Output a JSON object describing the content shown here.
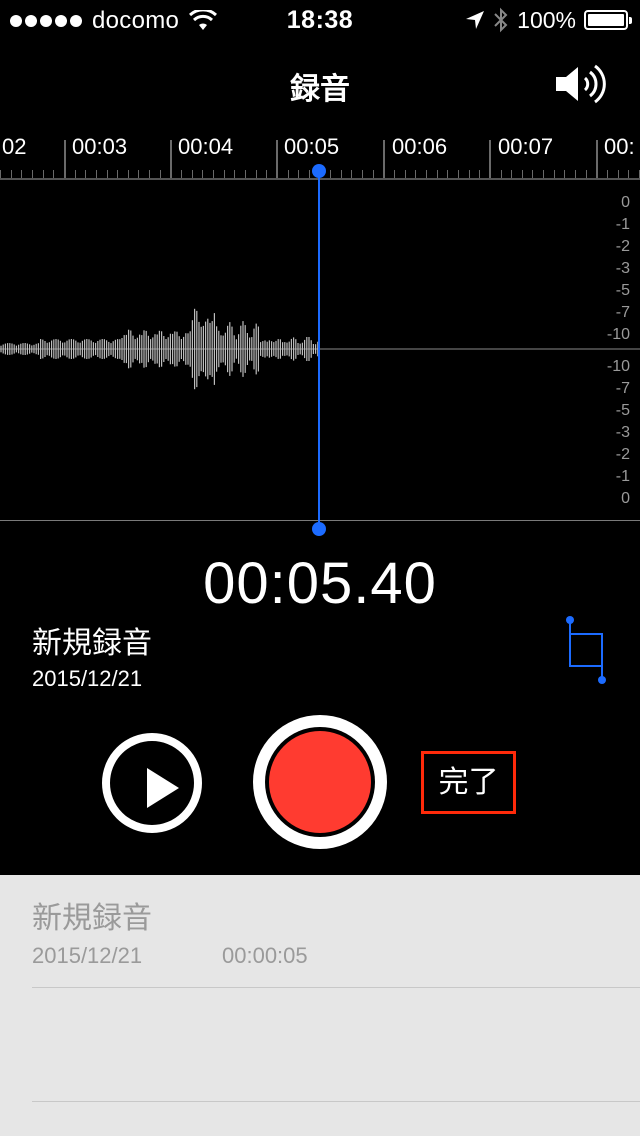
{
  "status_bar": {
    "carrier": "docomo",
    "time": "18:38",
    "battery_percent": "100%",
    "signal_bars": 5,
    "icons": [
      "wifi-icon",
      "location-arrow-icon",
      "bluetooth-icon",
      "battery-icon"
    ]
  },
  "nav": {
    "title": "録音",
    "speaker_icon": "speaker-icon"
  },
  "timeline": {
    "labels": [
      "02",
      "00:03",
      "00:04",
      "00:05",
      "00:06",
      "00:07",
      "00:"
    ]
  },
  "waveform": {
    "db_labels_top": [
      "0",
      "-1",
      "-2",
      "-3",
      "-5",
      "-7",
      "-10"
    ],
    "db_labels_bottom": [
      "-10",
      "-7",
      "-5",
      "-3",
      "-2",
      "-1",
      "0"
    ],
    "playhead_color": "#1c6bff"
  },
  "recording": {
    "elapsed": "00:05.40",
    "title": "新規録音",
    "date": "2015/12/21"
  },
  "controls": {
    "play_icon": "play-icon",
    "record_color": "#ff3b30",
    "done_label": "完了",
    "trim_icon": "trim-icon"
  },
  "list": {
    "items": [
      {
        "title": "新規録音",
        "date": "2015/12/21",
        "duration": "00:00:05"
      }
    ]
  }
}
